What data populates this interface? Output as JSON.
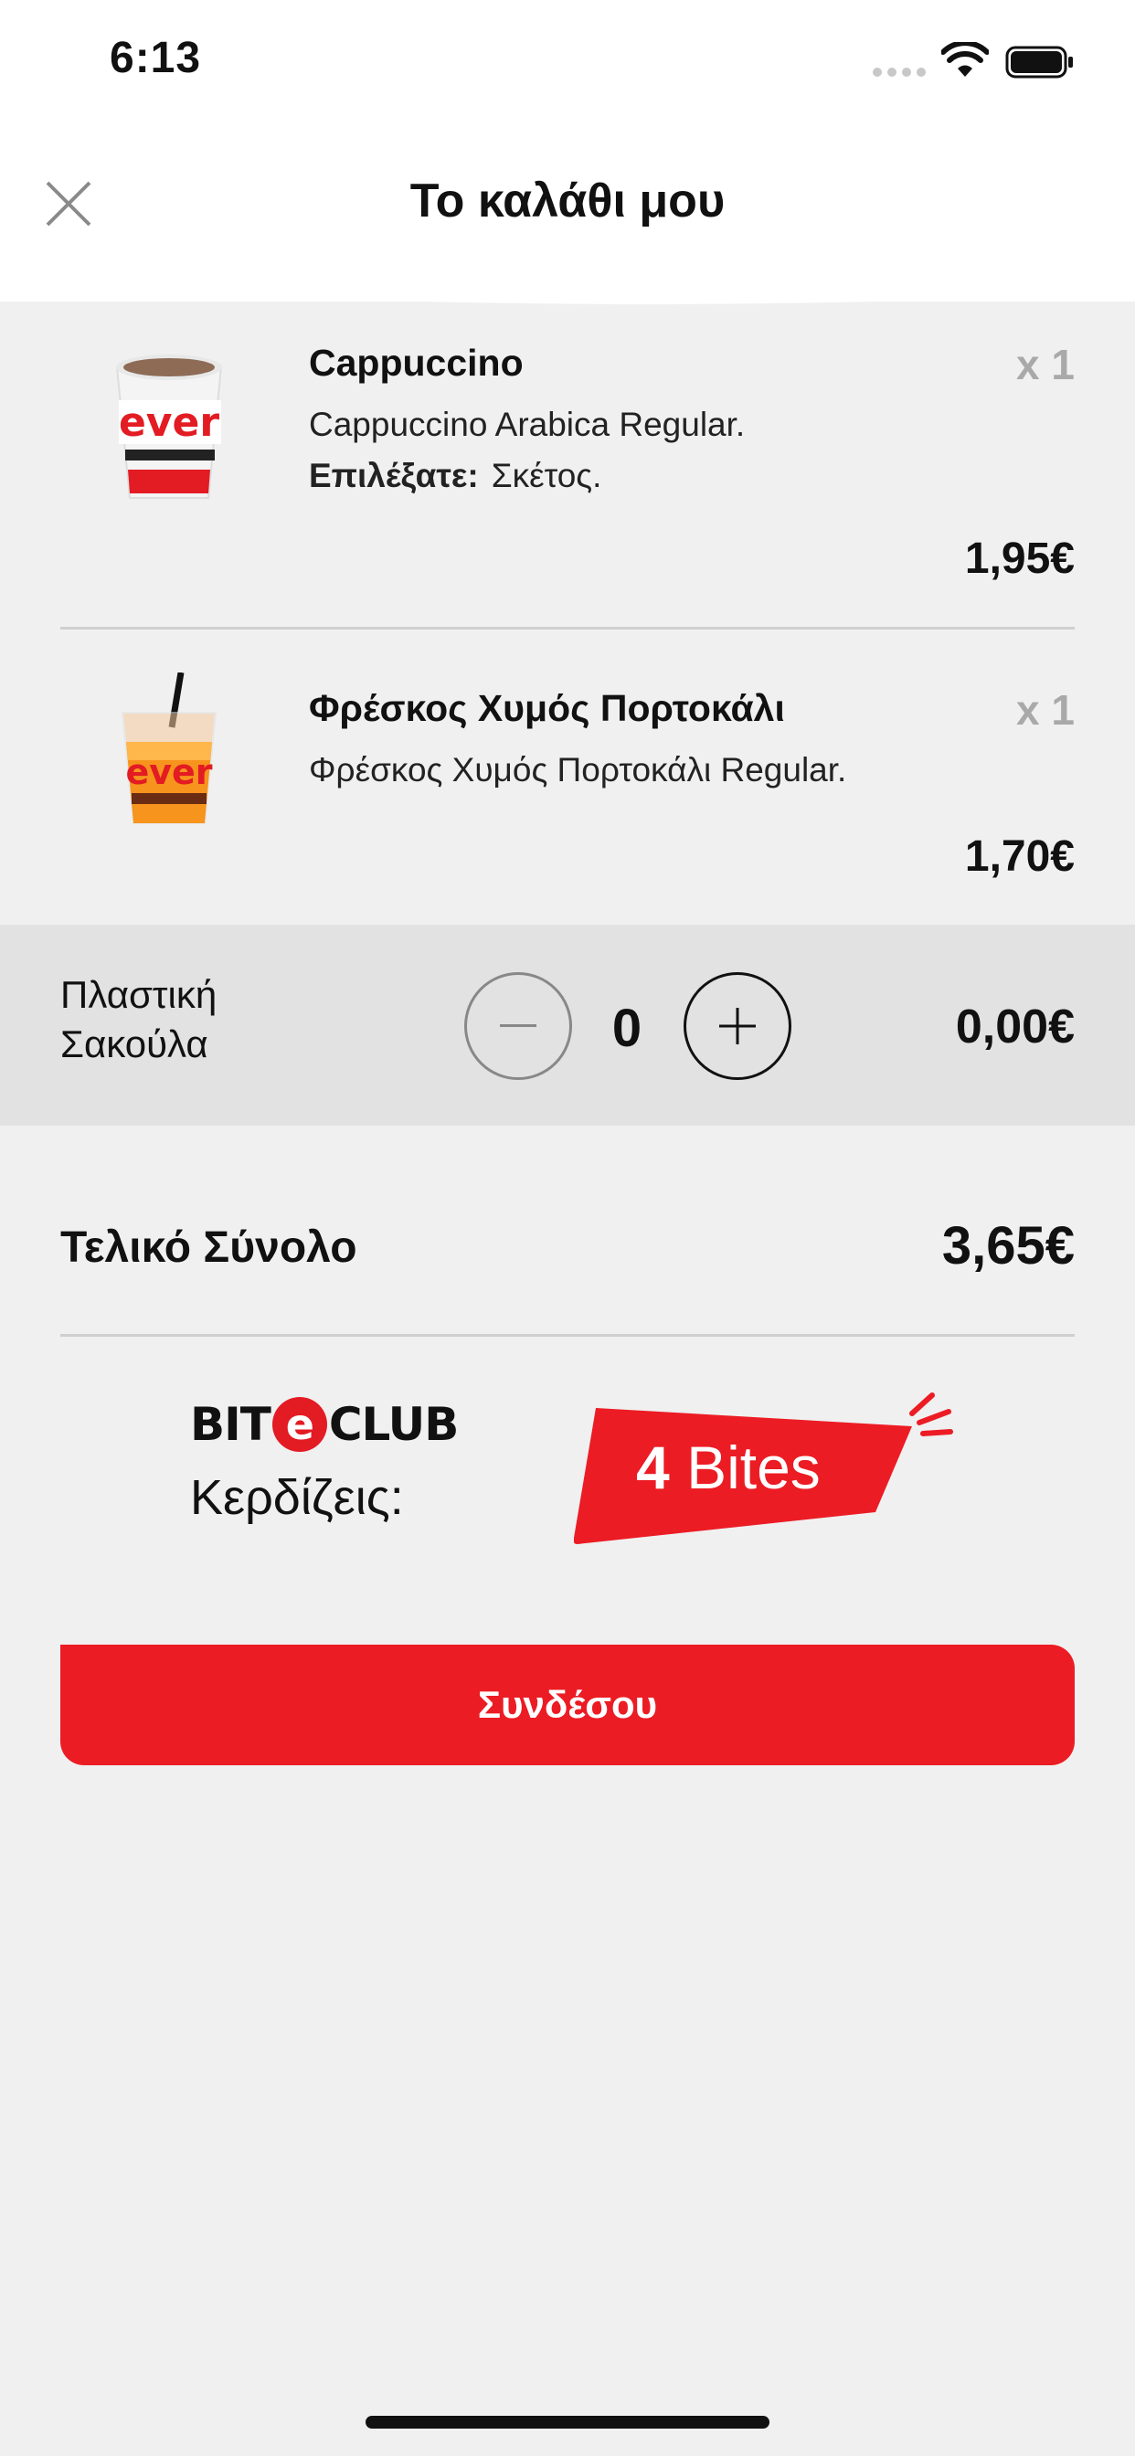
{
  "status_bar": {
    "time": "6:13"
  },
  "header": {
    "title": "Το καλάθι μου"
  },
  "items": [
    {
      "name": "Cappuccino",
      "quantity": "x 1",
      "description": "Cappuccino Arabica Regular.",
      "option_label": "Επιλέξατε:",
      "option_value": "Σκέτος.",
      "price": "1,95€",
      "image_text": "ever"
    },
    {
      "name": "Φρέσκος Χυμός Πορτοκάλι",
      "quantity": "x 1",
      "description": "Φρέσκος Χυμός Πορτοκάλι Regular.",
      "price": "1,70€",
      "image_text": "ever"
    }
  ],
  "bag": {
    "label_line1": "Πλαστική",
    "label_line2": "Σακούλα",
    "quantity": "0",
    "price": "0,00€"
  },
  "total": {
    "label": "Τελικό Σύνολο",
    "value": "3,65€"
  },
  "loyalty": {
    "logo_prefix": "BIT",
    "logo_e": "e",
    "logo_suffix": "CLUB",
    "earn_label": "Κερδίζεις:",
    "bites_count": "4",
    "bites_unit": "Bites"
  },
  "actions": {
    "login_label": "Συνδέσου"
  },
  "colors": {
    "accent": "#ec1c24",
    "background": "#f0f0f0",
    "bag_row": "#e2e2e2",
    "qty_gray": "#a9a9a9"
  }
}
